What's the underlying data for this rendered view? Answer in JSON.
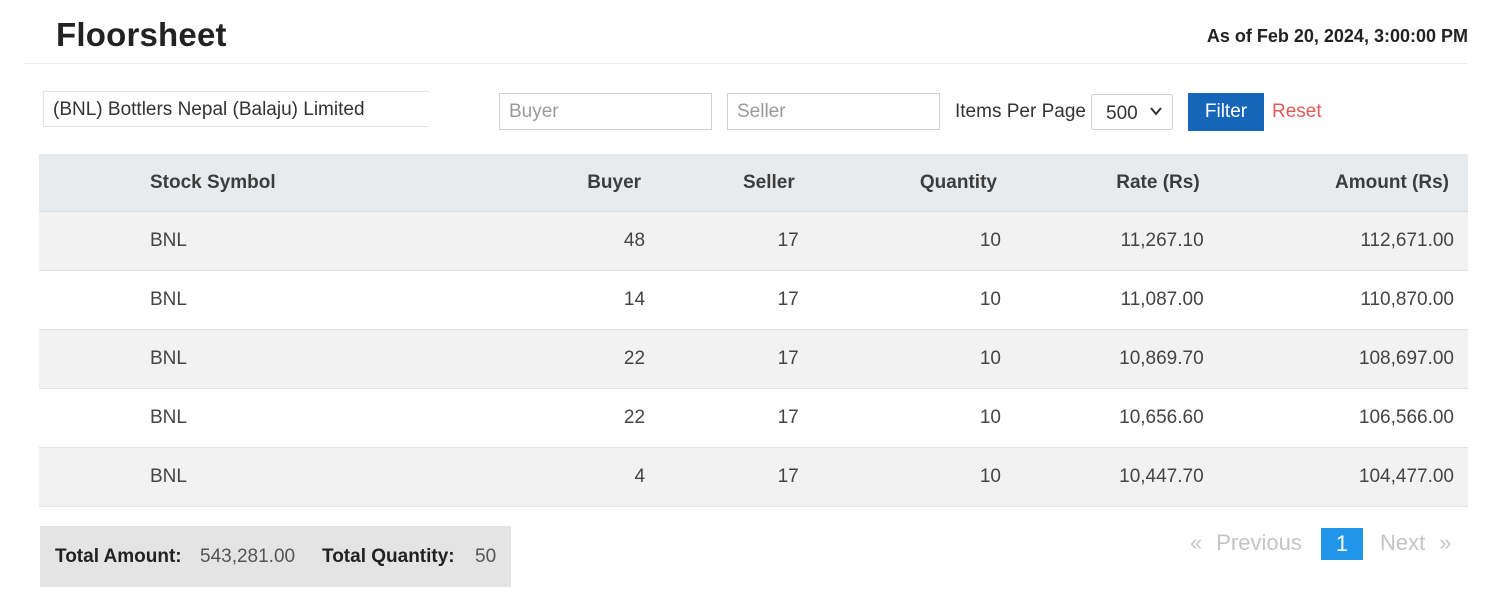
{
  "header": {
    "title": "Floorsheet",
    "as_of": "As of Feb 20, 2024, 3:00:00 PM"
  },
  "filters": {
    "company": "(BNL) Bottlers Nepal (Balaju) Limited",
    "buyer_placeholder": "Buyer",
    "buyer_value": "",
    "seller_placeholder": "Seller",
    "seller_value": "",
    "items_per_page_label": "Items Per Page",
    "items_per_page_value": "500",
    "filter_label": "Filter",
    "reset_label": "Reset"
  },
  "table": {
    "columns": [
      "Stock Symbol",
      "Buyer",
      "Seller",
      "Quantity",
      "Rate (Rs)",
      "Amount (Rs)"
    ],
    "rows": [
      [
        "BNL",
        "48",
        "17",
        "10",
        "11,267.10",
        "112,671.00"
      ],
      [
        "BNL",
        "14",
        "17",
        "10",
        "11,087.00",
        "110,870.00"
      ],
      [
        "BNL",
        "22",
        "17",
        "10",
        "10,869.70",
        "108,697.00"
      ],
      [
        "BNL",
        "22",
        "17",
        "10",
        "10,656.60",
        "106,566.00"
      ],
      [
        "BNL",
        "4",
        "17",
        "10",
        "10,447.70",
        "104,477.00"
      ]
    ]
  },
  "totals": {
    "amount_label": "Total Amount:",
    "amount_value": "543,281.00",
    "quantity_label": "Total Quantity:",
    "quantity_value": "50"
  },
  "pagination": {
    "prev_arrow": "«",
    "prev_label": "Previous",
    "current_page": "1",
    "next_label": "Next",
    "next_arrow": "»"
  },
  "colors": {
    "filter_button": "#1565b8",
    "reset_link": "#e05a5a",
    "current_page": "#2196e8",
    "table_header": "#e8ebee"
  }
}
